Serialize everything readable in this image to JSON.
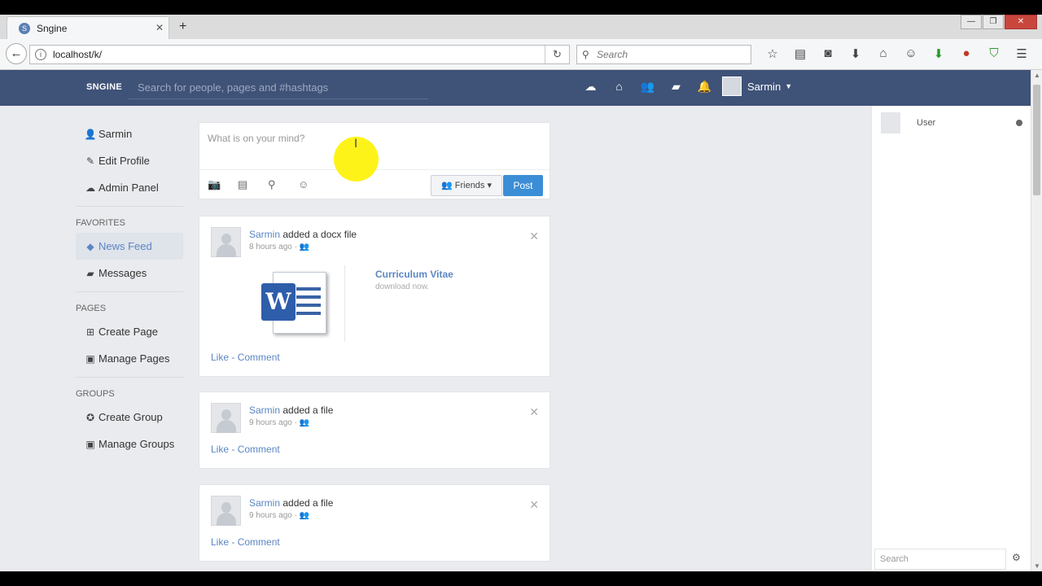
{
  "browser": {
    "tab_title": "Sngine",
    "favicon_letter": "S",
    "url": "localhost/k/",
    "search_placeholder": "Search",
    "window_controls": [
      "—",
      "❐",
      "✕"
    ]
  },
  "header": {
    "logo": "SNGINE",
    "search_placeholder": "Search for people, pages and #hashtags",
    "user_name": "Sarmin"
  },
  "sidebar": {
    "user": "Sarmin",
    "edit_profile": "Edit Profile",
    "admin_panel": "Admin Panel",
    "favorites_heading": "FAVORITES",
    "news_feed": "News Feed",
    "messages": "Messages",
    "pages_heading": "PAGES",
    "create_page": "Create Page",
    "manage_pages": "Manage Pages",
    "groups_heading": "GROUPS",
    "create_group": "Create Group",
    "manage_groups": "Manage Groups"
  },
  "publisher": {
    "placeholder": "What is on your mind?",
    "privacy": "Friends",
    "post": "Post"
  },
  "posts": [
    {
      "author": "Sarmin",
      "action": " added a docx file",
      "time": "8 hours ago",
      "file_title": "Curriculum Vitae",
      "file_sub": "download now.",
      "like": "Like",
      "sep": " - ",
      "comment": "Comment"
    },
    {
      "author": "Sarmin",
      "action": " added a file",
      "time": "9 hours ago",
      "like": "Like",
      "sep": " - ",
      "comment": "Comment"
    },
    {
      "author": "Sarmin",
      "action": " added a file",
      "time": "9 hours ago",
      "like": "Like",
      "sep": " - ",
      "comment": "Comment"
    }
  ],
  "right_sidebar": {
    "user": "User",
    "search_placeholder": "Search"
  }
}
